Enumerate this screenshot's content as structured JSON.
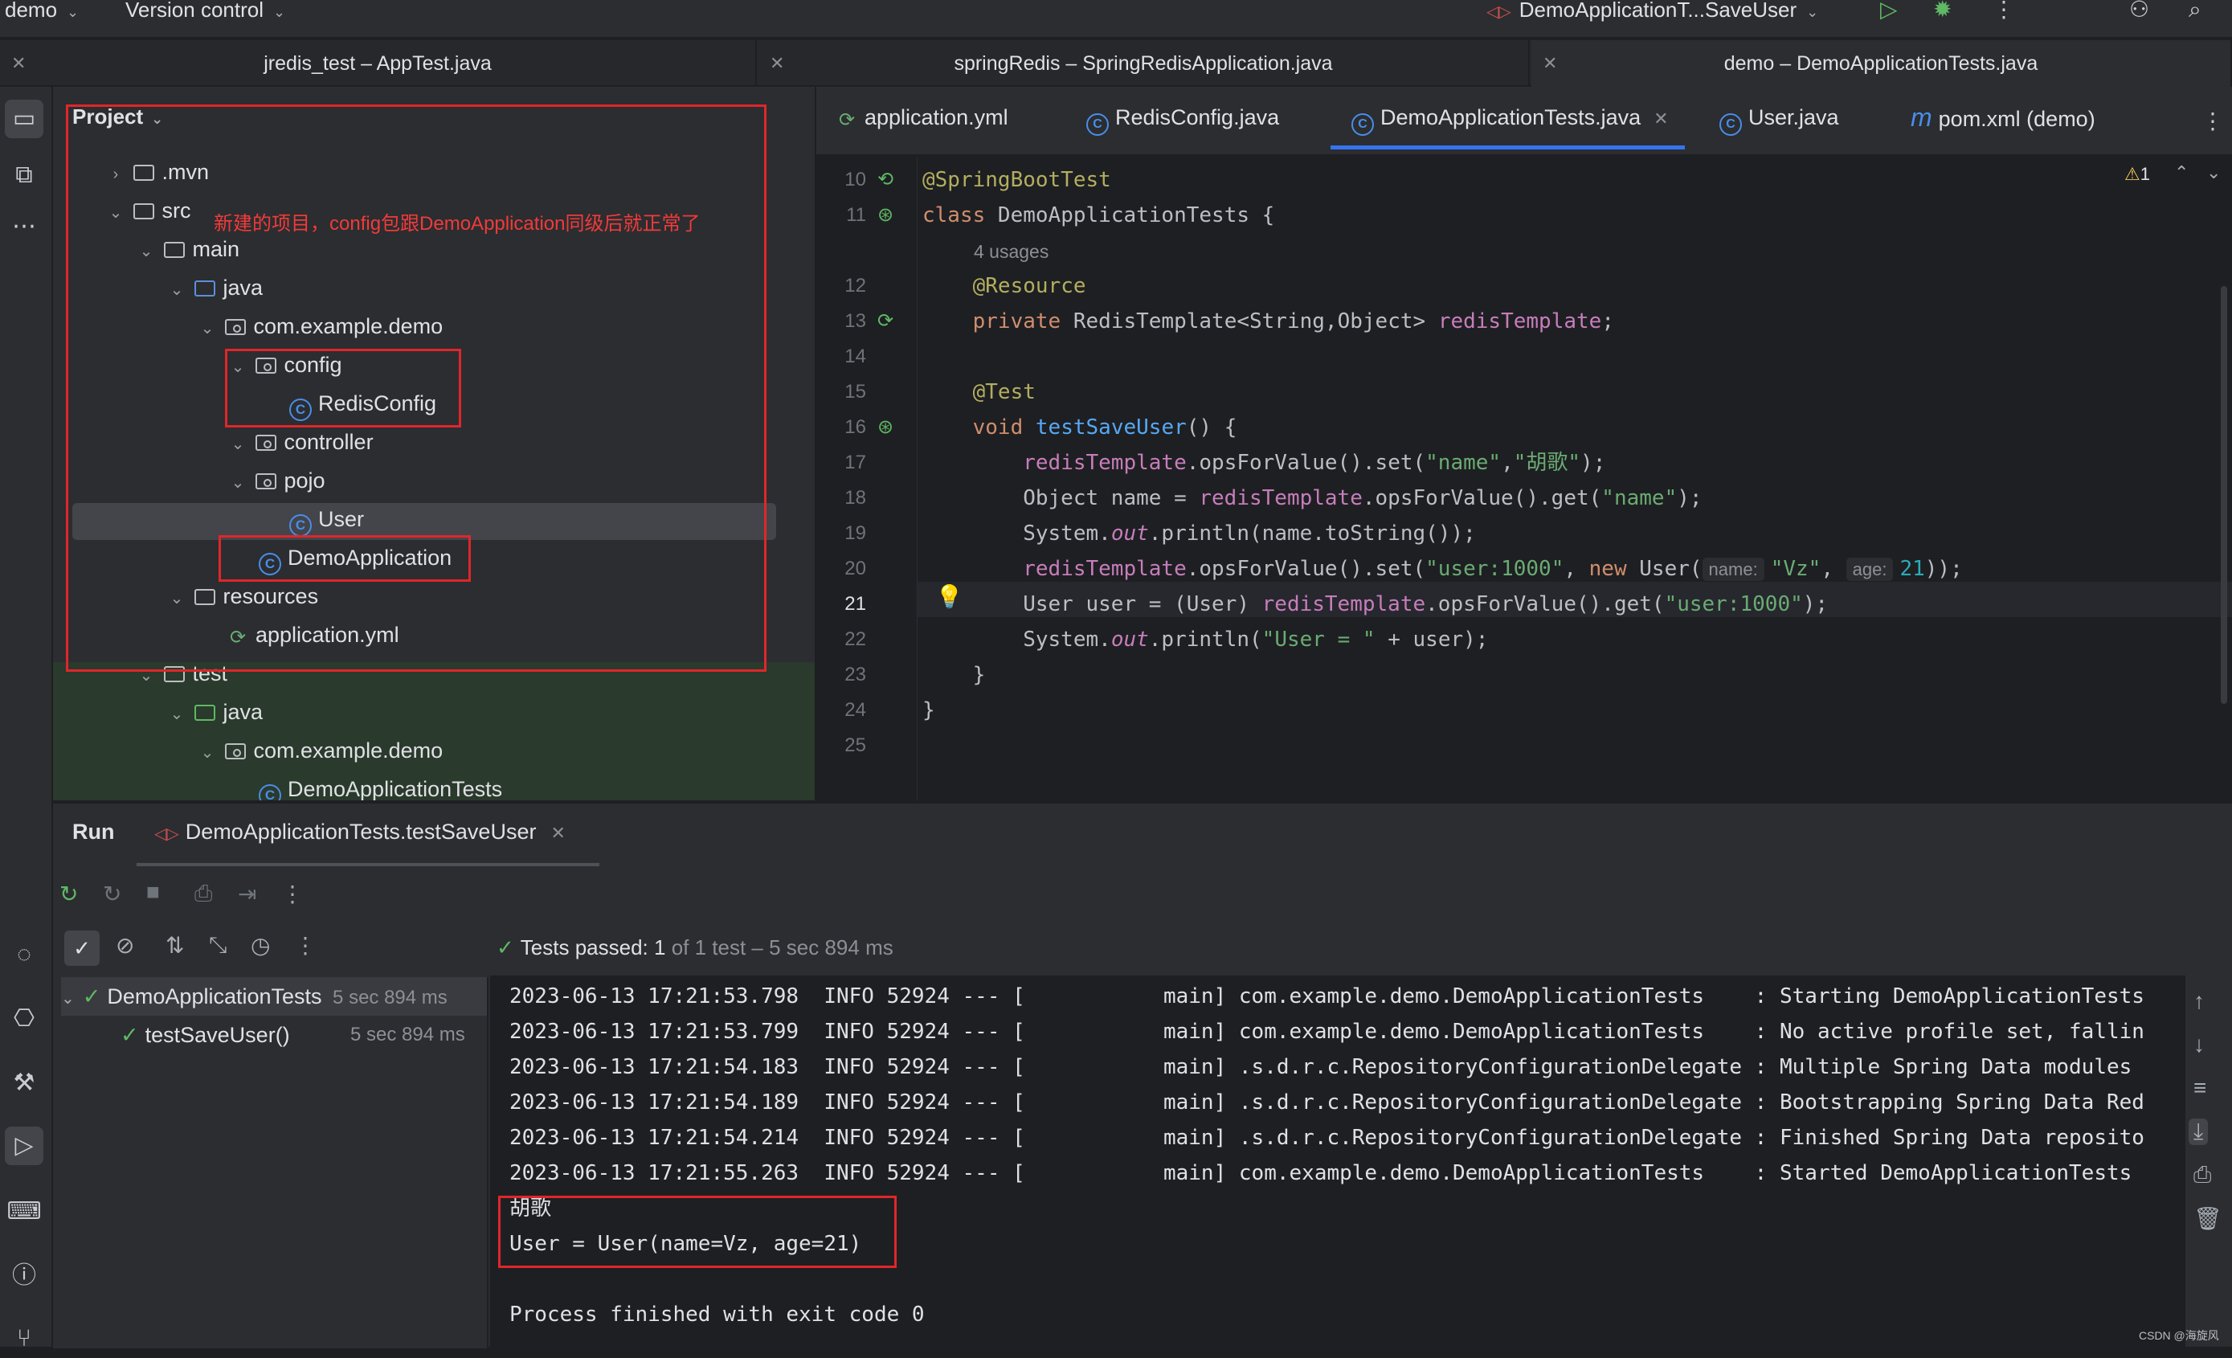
{
  "topbar": {
    "project_menu": "demo",
    "vcs_menu": "Version control",
    "run_config": "DemoApplicationT...SaveUser"
  },
  "window_tabs": [
    {
      "label": "jredis_test – AppTest.java"
    },
    {
      "label": "springRedis – SpringRedisApplication.java"
    },
    {
      "label": "demo – DemoApplicationTests.java"
    }
  ],
  "project": {
    "header": "Project",
    "annotation": "新建的项目，config包跟DemoApplication同级后就正常了",
    "tree": [
      {
        "label": ".mvn"
      },
      {
        "label": "src"
      },
      {
        "label": "main"
      },
      {
        "label": "java"
      },
      {
        "label": "com.example.demo"
      },
      {
        "label": "config"
      },
      {
        "label": "RedisConfig"
      },
      {
        "label": "controller"
      },
      {
        "label": "pojo"
      },
      {
        "label": "User"
      },
      {
        "label": "DemoApplication"
      },
      {
        "label": "resources"
      },
      {
        "label": "application.yml"
      },
      {
        "label": "test"
      },
      {
        "label": "java"
      },
      {
        "label": "com.example.demo"
      },
      {
        "label": "DemoApplicationTests"
      }
    ]
  },
  "editor_tabs": [
    {
      "label": "application.yml"
    },
    {
      "label": "RedisConfig.java"
    },
    {
      "label": "DemoApplicationTests.java"
    },
    {
      "label": "User.java"
    },
    {
      "label": "pom.xml (demo)"
    }
  ],
  "editor": {
    "warnings_count": "1",
    "usages": "4 usages",
    "line_numbers": [
      "10",
      "11",
      "12",
      "13",
      "14",
      "15",
      "16",
      "17",
      "18",
      "19",
      "20",
      "21",
      "22",
      "23",
      "24",
      "25"
    ],
    "hint_name": "name:",
    "hint_age": "age:"
  },
  "run": {
    "title": "Run",
    "tab_label": "DemoApplicationTests.testSaveUser",
    "tests_passed_label": "Tests passed: 1",
    "tests_passed_detail": "of 1 test – 5 sec 894 ms",
    "tree": [
      {
        "label": "DemoApplicationTests",
        "time": "5 sec 894 ms"
      },
      {
        "label": "testSaveUser()",
        "time": "5 sec 894 ms"
      }
    ],
    "console": [
      "2023-06-13 17:21:53.798  INFO 52924 --- [           main] com.example.demo.DemoApplicationTests    : Starting DemoApplicationTests",
      "2023-06-13 17:21:53.799  INFO 52924 --- [           main] com.example.demo.DemoApplicationTests    : No active profile set, fallin",
      "2023-06-13 17:21:54.183  INFO 52924 --- [           main] .s.d.r.c.RepositoryConfigurationDelegate : Multiple Spring Data modules",
      "2023-06-13 17:21:54.189  INFO 52924 --- [           main] .s.d.r.c.RepositoryConfigurationDelegate : Bootstrapping Spring Data Red",
      "2023-06-13 17:21:54.214  INFO 52924 --- [           main] .s.d.r.c.RepositoryConfigurationDelegate : Finished Spring Data reposito",
      "2023-06-13 17:21:55.263  INFO 52924 --- [           main] com.example.demo.DemoApplicationTests    : Started DemoApplicationTests",
      "胡歌",
      "User = User(name=Vz, age=21)",
      "",
      "Process finished with exit code 0"
    ]
  },
  "watermark": "CSDN @海旋风"
}
